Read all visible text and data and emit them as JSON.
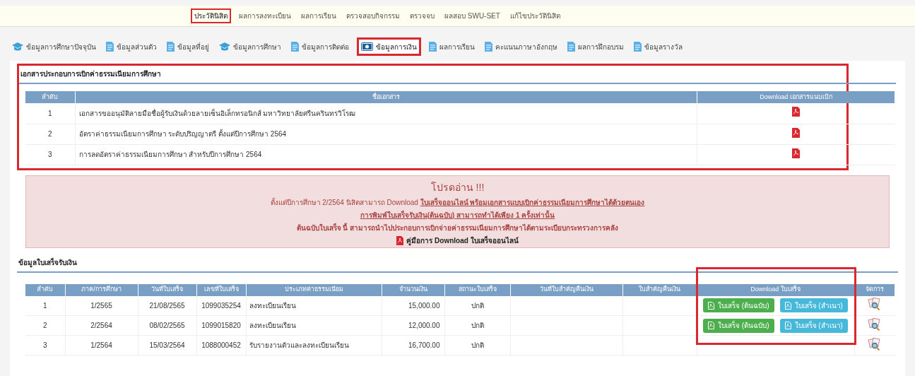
{
  "top_nav": [
    {
      "label": "ประวัตินิสิต",
      "selected": true
    },
    {
      "label": "ผลการลงทะเบียน",
      "selected": false
    },
    {
      "label": "ผลการเรียน",
      "selected": false
    },
    {
      "label": "ตรวจสอบกิจกรรม",
      "selected": false
    },
    {
      "label": "ตรวจจบ",
      "selected": false
    },
    {
      "label": "ผลสอบ SWU-SET",
      "selected": false
    },
    {
      "label": "แก้ไขประวัตินิสิต",
      "selected": false
    }
  ],
  "tabs": [
    {
      "label": "ข้อมูลการศึกษาปัจจุบัน",
      "kind": "cap",
      "selected": false
    },
    {
      "label": "ข้อมูลส่วนตัว",
      "kind": "doc",
      "selected": false
    },
    {
      "label": "ข้อมูลที่อยู่",
      "kind": "doc",
      "selected": false
    },
    {
      "label": "ข้อมูลการศึกษา",
      "kind": "cap",
      "selected": false
    },
    {
      "label": "ข้อมูลการติดต่อ",
      "kind": "doc",
      "selected": false
    },
    {
      "label": "ข้อมูลการเงิน",
      "kind": "money",
      "selected": true
    },
    {
      "label": "ผลการเรียน",
      "kind": "doc",
      "selected": false
    },
    {
      "label": "คะแนนภาษาอังกฤษ",
      "kind": "doc",
      "selected": false
    },
    {
      "label": "ผลการฝึกอบรม",
      "kind": "doc",
      "selected": false
    },
    {
      "label": "ข้อมูลรางวัล",
      "kind": "doc",
      "selected": false
    }
  ],
  "documents": {
    "title": "เอกสารประกอบการเบิกค่าธรรมเนียมการศึกษา",
    "columns": [
      "ลำดับ",
      "ชื่อเอกสาร",
      "Download เอกสารแนบเบิก"
    ],
    "rows": [
      {
        "no": "1",
        "name": "เอกสารขออนุมัติลายมือชื่อผู้รับเงินด้วยลายเซ็นอิเล็กทรอนิกส์ มหาวิทยาลัยศรีนครินทรวิโรฒ"
      },
      {
        "no": "2",
        "name": "อัตราค่าธรรมเนียมการศึกษา ระดับปริญญาตรี ตั้งแต่ปีการศึกษา 2564"
      },
      {
        "no": "3",
        "name": "การลดอัตราค่าธรรมเนียมการศึกษา สำหรับปีการศึกษา 2564"
      }
    ]
  },
  "notice": {
    "title": "โปรดอ่าน !!!",
    "line_1": "ตั้งแต่ปีการศึกษา 2/2564 นิสิตสามารถ Download ",
    "line_1_link": "ใบเสร็จออนไลน์ พร้อมเอกสารแบบเบิกค่าธรรมเนียมการศึกษาได้ด้วยตนเอง",
    "line_2": "การพิมพ์ใบเสร็จรับเงิน(ต้นฉบับ) สามารถทำได้เพียง 1 ครั้งเท่านั้น",
    "line_3": "ต้นฉบับใบเสร็จ นี้ สามารถนำไปประกอบการเบิกจ่ายค่าธรรมเนียมการศึกษาได้ตามระเบียบกระทรวงการคลัง",
    "manual_link": "คู่มือการ Download ใบเสร็จออนไลน์"
  },
  "receipts": {
    "title": "ข้อมูลใบเสร็จรับเงิน",
    "columns": [
      "ลำดับ",
      "ภาค/การศึกษา",
      "วันที่ใบเสร็จ",
      "เลขที่ใบเสร็จ",
      "ประเภทค่าธรรมเนียม",
      "จำนวนเงิน",
      "สถานะใบเสร็จ",
      "วันที่ใบสำคัญคืนเงิน",
      "ใบสำคัญคืนเงิน",
      "Download ใบเสร็จ",
      "จัดการ"
    ],
    "rows": [
      {
        "no": "1",
        "term": "1/2565",
        "date": "21/08/2565",
        "number": "1099035254",
        "fee_type": "ลงทะเบียนเรียน",
        "amount": "15,000.00",
        "status": "ปกติ",
        "downloads": [
          {
            "label": "ใบเสร็จ (ต้นฉบับ)",
            "kind": "original"
          },
          {
            "label": "ใบเสร็จ (สำเนา)",
            "kind": "copy"
          }
        ]
      },
      {
        "no": "2",
        "term": "2/2564",
        "date": "08/02/2565",
        "number": "1099015820",
        "fee_type": "ลงทะเบียนเรียน",
        "amount": "12,000.00",
        "status": "ปกติ",
        "downloads": [
          {
            "label": "ใบเสร็จ (ต้นฉบับ)",
            "kind": "original"
          },
          {
            "label": "ใบเสร็จ (สำเนา)",
            "kind": "copy"
          }
        ]
      },
      {
        "no": "3",
        "term": "1/2564",
        "date": "15/03/2564",
        "number": "1088000452",
        "fee_type": "รับรายงานตัวและลงทะเบียนเรียน",
        "amount": "16,700.00",
        "status": "ปกติ"
      }
    ]
  }
}
